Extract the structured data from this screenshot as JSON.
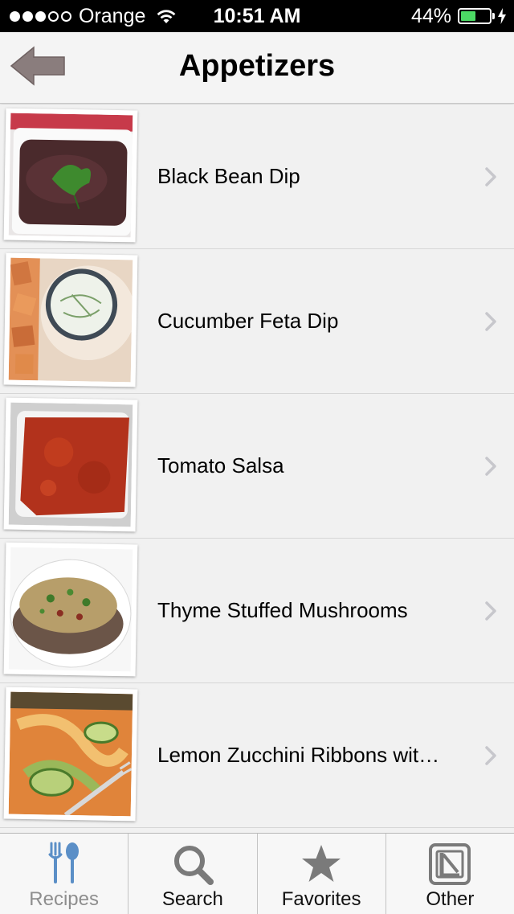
{
  "status_bar": {
    "signal_dots_filled": 3,
    "signal_dots_total": 5,
    "carrier": "Orange",
    "time": "10:51 AM",
    "battery_percent": "44%",
    "battery_color": "#4cd964"
  },
  "nav": {
    "title": "Appetizers",
    "back_icon": "back-arrow-icon"
  },
  "recipes": [
    {
      "title": "Black Bean Dip",
      "thumbnail": "black-bean-dip-photo"
    },
    {
      "title": "Cucumber Feta Dip",
      "thumbnail": "cucumber-feta-dip-photo"
    },
    {
      "title": "Tomato Salsa",
      "thumbnail": "tomato-salsa-photo"
    },
    {
      "title": "Thyme Stuffed Mushrooms",
      "thumbnail": "thyme-stuffed-mushrooms-photo"
    },
    {
      "title": "Lemon Zucchini Ribbons wit…",
      "thumbnail": "lemon-zucchini-ribbons-photo"
    }
  ],
  "tabs": [
    {
      "label": "Recipes",
      "icon": "fork-spoon-icon",
      "active": true
    },
    {
      "label": "Search",
      "icon": "magnifier-icon",
      "active": false
    },
    {
      "label": "Favorites",
      "icon": "star-icon",
      "active": false
    },
    {
      "label": "Other",
      "icon": "other-app-icon",
      "active": false
    }
  ],
  "colors": {
    "tab_active_icon": "#5b8fc7",
    "tab_inactive_icon": "#7a7a7a",
    "chevron": "#c7c7cc"
  }
}
